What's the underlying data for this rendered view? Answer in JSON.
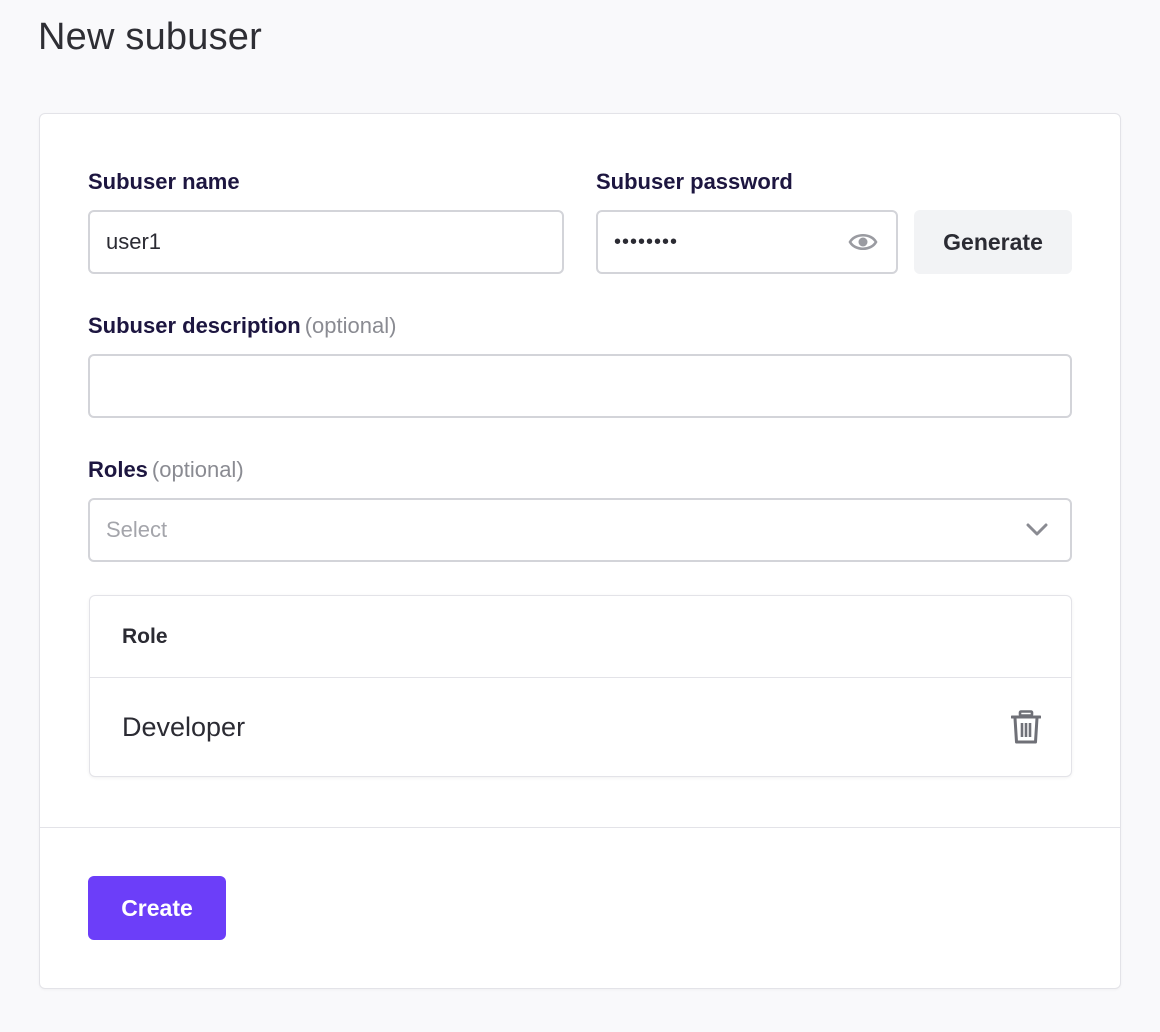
{
  "page": {
    "title": "New subuser"
  },
  "form": {
    "name": {
      "label": "Subuser name",
      "value": "user1"
    },
    "password": {
      "label": "Subuser password",
      "value": "••••••••",
      "generate_label": "Generate"
    },
    "description": {
      "label": "Subuser description",
      "optional": "(optional)",
      "value": ""
    },
    "roles": {
      "label": "Roles",
      "optional": "(optional)",
      "placeholder": "Select"
    }
  },
  "roles_table": {
    "header": "Role",
    "rows": [
      {
        "role": "Developer"
      }
    ]
  },
  "actions": {
    "create_label": "Create"
  },
  "icons": {
    "password_toggle": "eye-icon",
    "dropdown": "chevron-down-icon",
    "delete": "trash-icon"
  },
  "colors": {
    "primary": "#6c3ef9",
    "label": "#1d1640",
    "background": "#f9f9fb"
  }
}
